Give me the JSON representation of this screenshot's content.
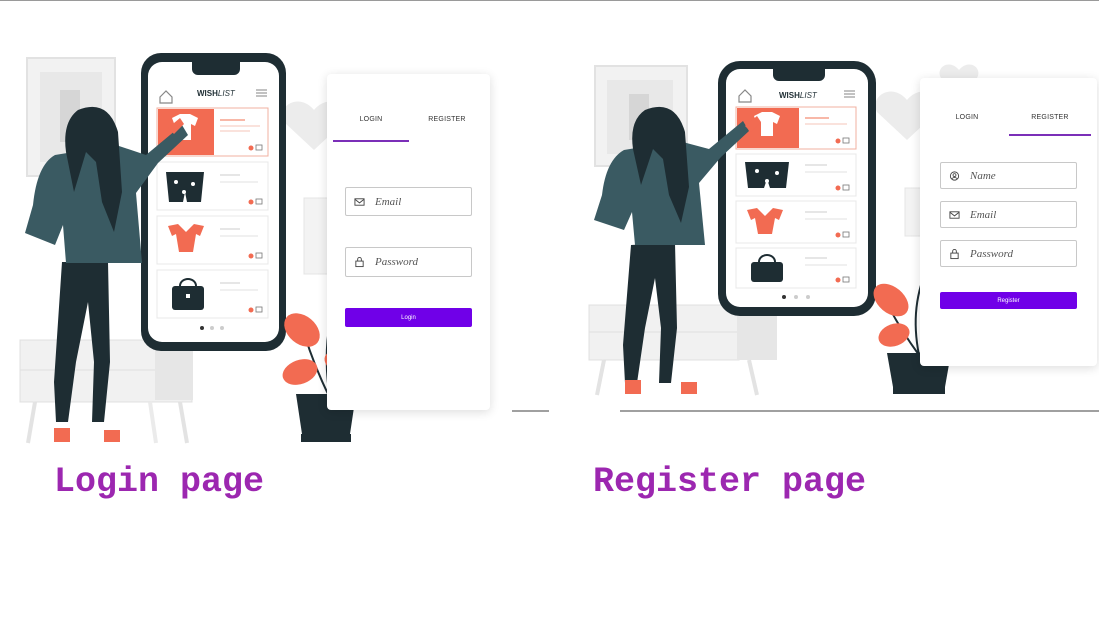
{
  "login_screen": {
    "brand_bold": "WISH",
    "brand_light": "LIST",
    "tabs": [
      {
        "label": "LOGIN",
        "active": true
      },
      {
        "label": "REGISTER",
        "active": false
      }
    ],
    "fields": [
      {
        "icon": "mail-icon",
        "placeholder": "Email"
      },
      {
        "icon": "lock-icon",
        "placeholder": "Password"
      }
    ],
    "submit_label": "Login",
    "caption": "Login page"
  },
  "register_screen": {
    "brand_bold": "WISH",
    "brand_light": "LIST",
    "tabs": [
      {
        "label": "LOGIN",
        "active": false
      },
      {
        "label": "REGISTER",
        "active": true
      }
    ],
    "fields": [
      {
        "icon": "user-icon",
        "placeholder": "Name"
      },
      {
        "icon": "mail-icon",
        "placeholder": "Email"
      },
      {
        "icon": "lock-icon",
        "placeholder": "Password"
      }
    ],
    "submit_label": "Register",
    "caption": "Register page"
  },
  "colors": {
    "accent_purple": "#7000e8",
    "caption_purple": "#9c27b0",
    "tab_underline": "#7b2fb8",
    "coral": "#f26b52",
    "dark_teal": "#1e2d33",
    "jacket": "#3a5a62"
  }
}
